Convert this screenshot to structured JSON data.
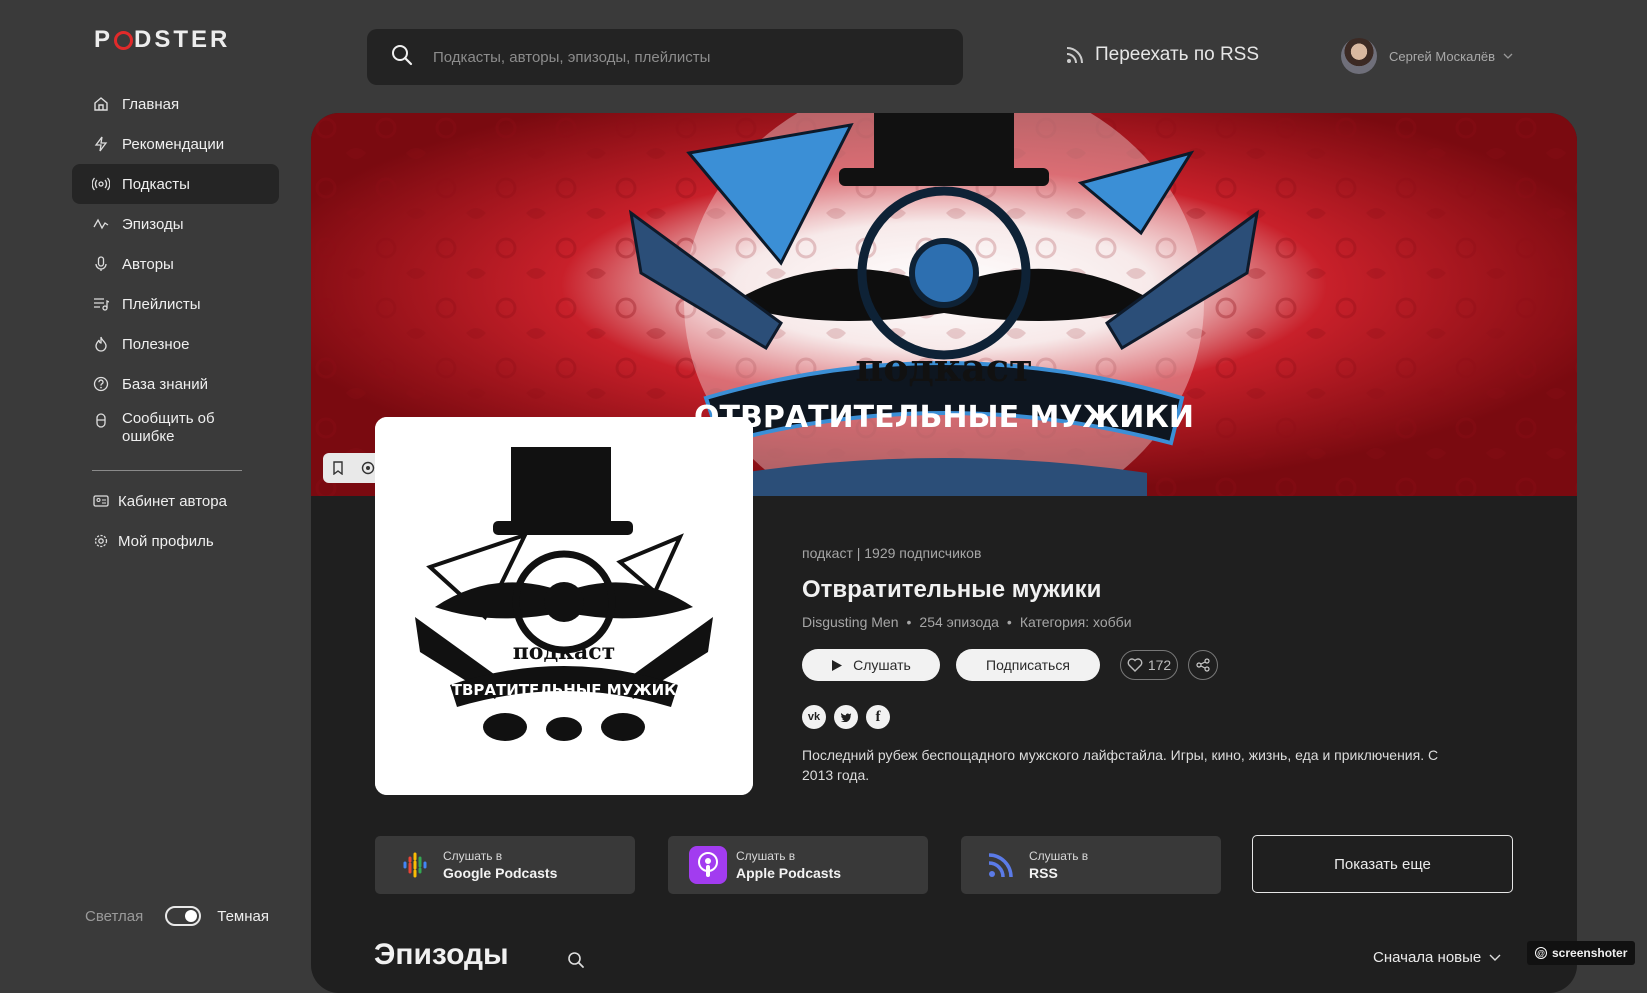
{
  "app": {
    "logo_left": "P",
    "logo_right": "DSTER"
  },
  "sidebar": {
    "items": [
      {
        "label": "Главная",
        "icon": "home-icon"
      },
      {
        "label": "Рекомендации",
        "icon": "lightning-icon"
      },
      {
        "label": "Подкасты",
        "icon": "broadcast-icon",
        "active": true
      },
      {
        "label": "Эпизоды",
        "icon": "pulse-icon"
      },
      {
        "label": "Авторы",
        "icon": "microphone-icon"
      },
      {
        "label": "Плейлисты",
        "icon": "playlist-icon"
      },
      {
        "label": "Полезное",
        "icon": "flame-icon"
      },
      {
        "label": "База знаний",
        "icon": "question-icon"
      },
      {
        "label": "Сообщить об ошибке",
        "icon": "bug-icon"
      }
    ],
    "secondary": [
      {
        "label": "Кабинет автора",
        "icon": "id-card-icon"
      },
      {
        "label": "Мой профиль",
        "icon": "gear-icon"
      }
    ],
    "theme": {
      "light": "Светлая",
      "dark": "Темная",
      "mode": "dark"
    }
  },
  "header": {
    "search_placeholder": "Подкасты, авторы, эпизоды, плейлисты",
    "rss_move": "Переехать по RSS",
    "user_name": "Сергей Москалёв"
  },
  "podcast": {
    "meta": "подкаст | 1929 подписчиков",
    "title": "Отвратительные мужики",
    "author": "Disgusting Men",
    "episodes": "254 эпизода",
    "category": "Категория: хобби",
    "play_label": "Слушать",
    "subscribe_label": "Подписаться",
    "likes": "172",
    "socials": [
      "vk",
      "twitter",
      "facebook"
    ],
    "description": "Последний рубеж беспощадного мужского лайфстайла. Игры, кино, жизнь, еда и приключения. С 2013 года.",
    "cover_text_top": "подкаст",
    "cover_text_banner": "ОТВРАТИТЕЛЬНЫЕ МУЖИКИ"
  },
  "platforms": [
    {
      "small": "Слушать в",
      "big": "Google Podcasts",
      "icon": "google-podcasts-icon"
    },
    {
      "small": "Слушать в",
      "big": "Apple Podcasts",
      "icon": "apple-podcasts-icon"
    },
    {
      "small": "Слушать в",
      "big": "RSS",
      "icon": "rss-icon"
    }
  ],
  "show_more": "Показать еще",
  "episodes_section": {
    "title": "Эпизоды",
    "sort": "Сначала новые"
  },
  "watermark": "screenshoter",
  "colors": {
    "accent": "#e12a2a",
    "banner_red": "#b3121a",
    "panel": "#1f1f1f",
    "sidebar_bg": "#3a3a3a"
  }
}
